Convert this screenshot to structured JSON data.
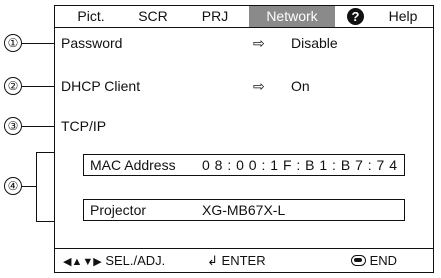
{
  "tabs": [
    {
      "label": "Pict."
    },
    {
      "label": "SCR"
    },
    {
      "label": "PRJ"
    },
    {
      "label": "Network"
    },
    {
      "label": "Help"
    }
  ],
  "rows": {
    "password": {
      "label": "Password",
      "value": "Disable"
    },
    "dhcp": {
      "label": "DHCP Client",
      "value": "On"
    },
    "tcpip": {
      "label": "TCP/IP"
    }
  },
  "info": {
    "mac_label": "MAC Address",
    "mac_value": "0 8 : 0 0 : 1 F : B 1 : B 7 : 7 4",
    "projector_label": "Projector",
    "projector_value": "XG-MB67X-L"
  },
  "callouts": [
    "①",
    "②",
    "③",
    "④"
  ],
  "footer": {
    "sel": "SEL./ADJ.",
    "enter": "ENTER",
    "end": "END"
  },
  "icons": {
    "select_arrow": "◇▷ pointing arrow",
    "help": "question-mark icon"
  }
}
